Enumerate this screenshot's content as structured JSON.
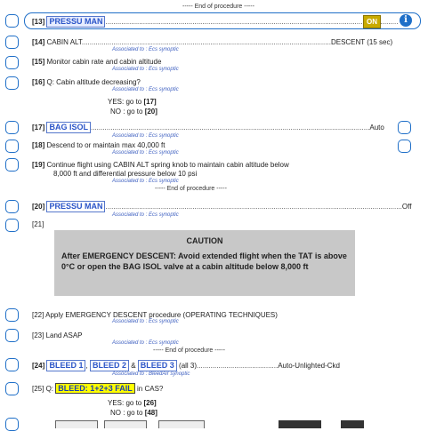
{
  "top_end": "----- End of procedure -----",
  "step13": {
    "num": "[13]",
    "label": "PRESSU MAN",
    "state": "ON"
  },
  "step14": {
    "num": "[14]",
    "label": "CABIN ALT",
    "value": "DESCENT (15 sec)",
    "assoc": "Associated to : Ecs synoptic"
  },
  "step15": {
    "num": "[15]",
    "label": "Monitor cabin rate and cabin altitude",
    "assoc": "Associated to : Ecs synoptic"
  },
  "step16": {
    "num": "[16]",
    "label": "Q: Cabin altitude decreasing?",
    "assoc": "Associated to : Ecs synoptic",
    "yes": "YES: go to ",
    "yes_ref": "[17]",
    "no": "NO : go to ",
    "no_ref": "[20]"
  },
  "step17": {
    "num": "[17]",
    "label": "BAG ISOL",
    "value": "Auto",
    "assoc": "Associated to : Ecs synoptic"
  },
  "step18": {
    "num": "[18]",
    "label": "Descend to or maintain max 40,000 ft",
    "assoc": "Associated to : Ecs synoptic"
  },
  "step19": {
    "num": "[19]",
    "line1": "Continue flight using CABIN ALT spring knob to maintain cabin altitude below",
    "line2": "8,000 ft and differential pressure below 10 psi",
    "assoc": "Associated to : Ecs synoptic",
    "end": "----- End of procedure -----"
  },
  "step20": {
    "num": "[20]",
    "label": "PRESSU MAN",
    "value": "Off",
    "assoc": "Associated to : Ecs synoptic"
  },
  "step21": {
    "num": "[21]"
  },
  "caution": {
    "title": "CAUTION",
    "text": "After EMERGENCY DESCENT: Avoid extended flight when the TAT is above 0°C or open the BAG ISOL valve at a cabin altitude below 8,000 ft"
  },
  "step22": {
    "num": "[22]",
    "label": "Apply EMERGENCY DESCENT procedure (OPERATING TECHNIQUES)",
    "assoc": "Associated to : Ecs synoptic"
  },
  "step23": {
    "num": "[23]",
    "label": "Land ASAP",
    "assoc": "Associated to : Ecs synoptic",
    "end": "----- End of procedure -----"
  },
  "step24": {
    "num": "[24]",
    "b1": "BLEED 1",
    "b2": "BLEED 2",
    "amp": "&",
    "b3": "BLEED 3",
    "all": "(all 3)",
    "value": "Auto-Unlighted-Ckd",
    "assoc": "Associated to : BleedAir synoptic"
  },
  "step25": {
    "num": "[25]",
    "q": "Q:",
    "tag": "BLEED: 1+2+3 FAIL",
    "cas": "in CAS?",
    "yes": "YES: go to ",
    "yes_ref": "[26]",
    "no": "NO : go to ",
    "no_ref": "[48]"
  },
  "colors": {
    "accent": "#1f6fc8",
    "highlight": "#ffff00",
    "on_badge": "#d8b600"
  }
}
